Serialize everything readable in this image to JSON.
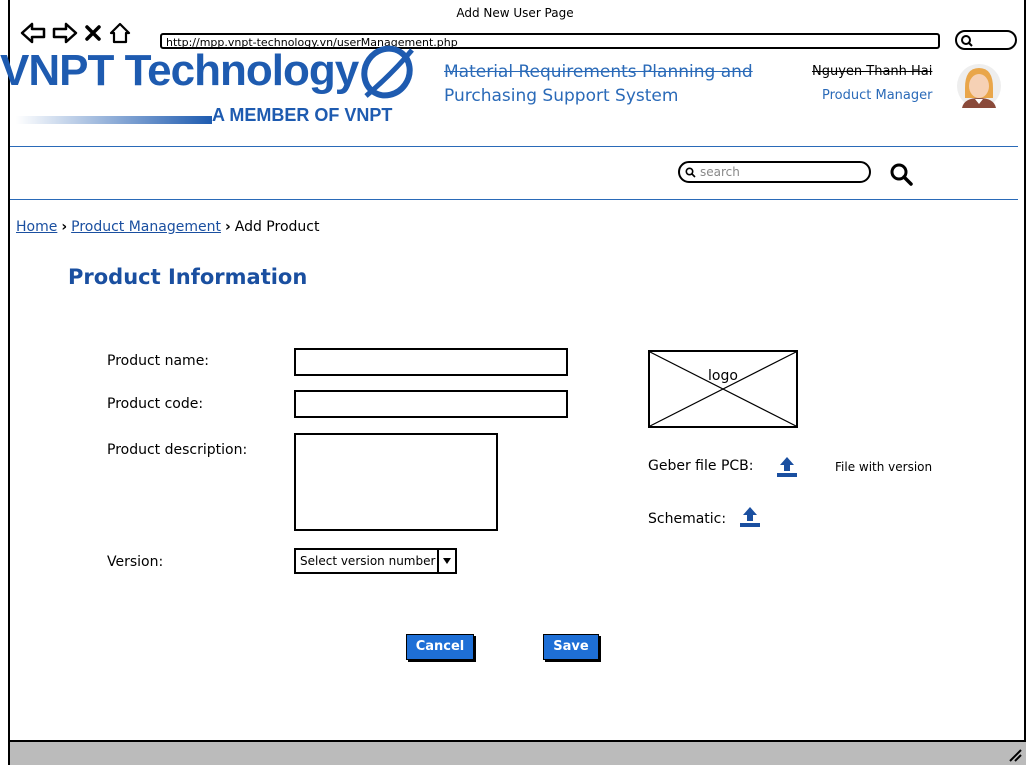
{
  "window": {
    "title": "Add New User Page"
  },
  "browser": {
    "url": "http://mpp.vnpt-technology.vn/userManagement.php"
  },
  "brand": {
    "name": "VNPT Technology",
    "tagline": "A MEMBER OF VNPT",
    "color": "#1e5bb0"
  },
  "system": {
    "title_line1": "Material Requirements Planning and",
    "title_line2": "Purchasing Support System"
  },
  "user": {
    "name": "Nguyen Thanh Hai",
    "role": "Product Manager"
  },
  "search": {
    "placeholder": "search"
  },
  "breadcrumb": {
    "home": "Home",
    "section": "Product Management",
    "current": "Add Product"
  },
  "form": {
    "heading": "Product Information",
    "name_label": "Product name:",
    "name_value": "",
    "code_label": "Product code:",
    "code_value": "",
    "description_label": "Product description:",
    "description_value": "",
    "version_label": "Version:",
    "version_selected": "Select version number"
  },
  "attachments": {
    "logo_label": "logo",
    "gerber_label": "Geber file PCB:",
    "gerber_note": "File with version",
    "schematic_label": "Schematic:"
  },
  "actions": {
    "cancel": "Cancel",
    "save": "Save",
    "button_color": "#1e6fd6"
  },
  "icons": [
    "back-icon",
    "forward-icon",
    "close-icon",
    "home-icon",
    "search-icon",
    "upload-icon",
    "avatar",
    "resize-icon"
  ]
}
